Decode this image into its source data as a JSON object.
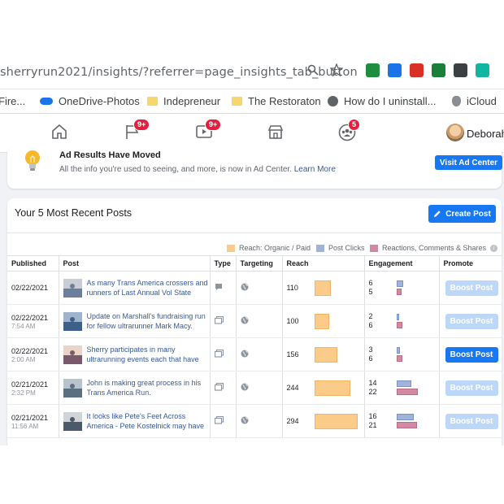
{
  "browser": {
    "url": "sherryrun2021/insights/?referrer=page_insights_tab_button",
    "bookmarks": [
      {
        "label": "Fire...",
        "icon": "firefox-icon"
      },
      {
        "label": "OneDrive-Photos",
        "icon": "cloud-icon"
      },
      {
        "label": "Indepreneur",
        "icon": "folder-icon"
      },
      {
        "label": "The Restoraton",
        "icon": "folder-icon"
      },
      {
        "label": "How do I uninstall...",
        "icon": "globe-icon"
      },
      {
        "label": "iCloud",
        "icon": "apple-icon"
      }
    ],
    "extension_colors": [
      "#1e8e3e",
      "#1a73e8",
      "#d93025",
      "#188038",
      "#3c4043",
      "#12b5a2"
    ]
  },
  "fbnav": {
    "badges": {
      "flag": "9+",
      "video": "9+",
      "groups": "5"
    },
    "user_name": "Deborah"
  },
  "ad_notice": {
    "title": "Ad Results Have Moved",
    "desc": "All the info you're used to seeing, and more, is now in Ad Center.",
    "link": "Learn More",
    "button": "Visit Ad Center"
  },
  "posts": {
    "title": "Your 5 Most Recent Posts",
    "create_label": "Create Post",
    "legend": [
      {
        "label": "Reach: Organic / Paid",
        "color": "#fbcb8a"
      },
      {
        "label": "Post Clicks",
        "color": "#a0b3d8"
      },
      {
        "label": "Reactions, Comments & Shares",
        "color": "#d18aa1"
      }
    ],
    "columns": [
      "Published",
      "Post",
      "Type",
      "Targeting",
      "Reach",
      "Engagement",
      "Promote"
    ],
    "rows": [
      {
        "date": "02/22/2021",
        "time": "",
        "text": "As many Trans America crossers and runners of Last Annual Vol State",
        "reach": 110,
        "clicks": 6,
        "reactions": 5,
        "boost": "Boost Post",
        "boost_enabled": false
      },
      {
        "date": "02/22/2021",
        "time": "7:54 AM",
        "text": "Update on Marshall's fundraising run for fellow ultrarunner Mark Macy.",
        "reach": 100,
        "clicks": 2,
        "reactions": 6,
        "boost": "Boost Post",
        "boost_enabled": false
      },
      {
        "date": "02/22/2021",
        "time": "2:00 AM",
        "text": "Sherry participates in many ultrarunning events each that have",
        "reach": 156,
        "clicks": 3,
        "reactions": 6,
        "boost": "Boost Post",
        "boost_enabled": true
      },
      {
        "date": "02/21/2021",
        "time": "2:32 PM",
        "text": "John is making great process in his Trans America Run.",
        "reach": 244,
        "clicks": 14,
        "reactions": 22,
        "boost": "Boost Post",
        "boost_enabled": false
      },
      {
        "date": "02/21/2021",
        "time": "11:56 AM",
        "text": "It looks like Pete's Feet Across America - Pete Kostelnick may have",
        "reach": 294,
        "clicks": 16,
        "reactions": 21,
        "boost": "Boost Post",
        "boost_enabled": false
      }
    ]
  }
}
